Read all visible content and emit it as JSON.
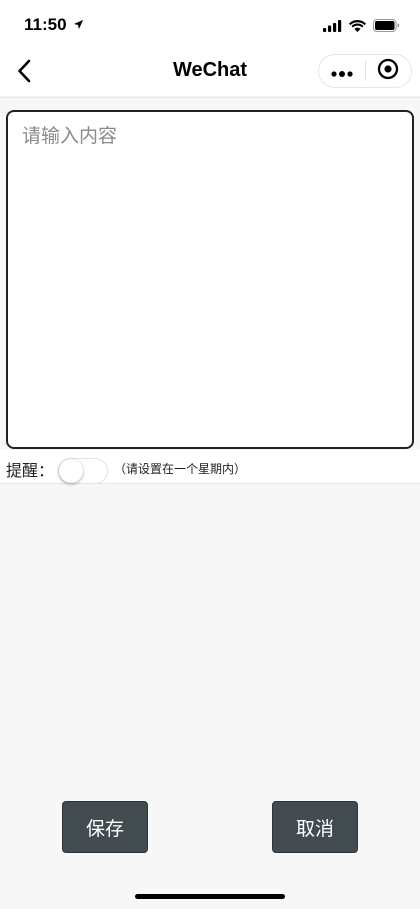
{
  "status_bar": {
    "time": "11:50",
    "icons": [
      "location-arrow-icon",
      "signal-icon",
      "wifi-icon",
      "battery-icon"
    ]
  },
  "nav": {
    "title": "WeChat",
    "back_icon": "chevron-left-icon",
    "menu_icon": "more-dots-icon",
    "close_icon": "target-icon"
  },
  "content": {
    "placeholder": "请输入内容",
    "value": ""
  },
  "reminder": {
    "label": "提醒：",
    "enabled": false,
    "hint": "（请设置在一个星期内）"
  },
  "actions": {
    "save_label": "保存",
    "cancel_label": "取消"
  },
  "colors": {
    "button_bg": "#424b4f",
    "page_bg": "#f7f7f7",
    "input_border": "#222222"
  }
}
